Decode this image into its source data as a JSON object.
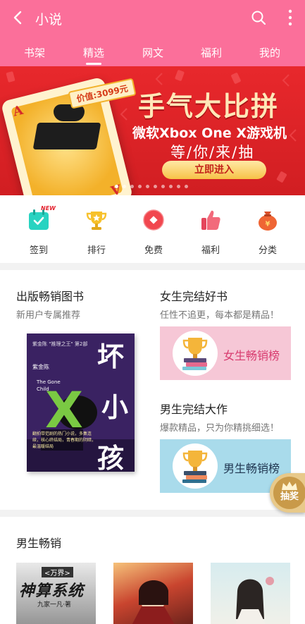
{
  "header": {
    "title": "小说",
    "tabs": [
      {
        "label": "书架"
      },
      {
        "label": "精选"
      },
      {
        "label": "网文"
      },
      {
        "label": "福利"
      },
      {
        "label": "我的"
      }
    ],
    "active_tab": "精选"
  },
  "banner": {
    "price": "价值:3099元",
    "headline": "手气大比拼",
    "subline": "微软Xbox One X游戏机",
    "tagline": "等/你/来/抽",
    "button": "立即进入",
    "card_letter": "A",
    "dot_count": 10,
    "active_dot": 0
  },
  "quick_nav": [
    {
      "label": "签到",
      "icon": "calendar-check-icon",
      "badge": "NEW"
    },
    {
      "label": "排行",
      "icon": "trophy-icon"
    },
    {
      "label": "免费",
      "icon": "diamond-coin-icon"
    },
    {
      "label": "福利",
      "icon": "thumbs-up-icon"
    },
    {
      "label": "分类",
      "icon": "money-bag-icon"
    }
  ],
  "section_featured": {
    "left": {
      "title": "出版畅销图书",
      "subtitle": "新用户专属推荐",
      "book": {
        "title_chars": [
          "坏",
          "小",
          "孩"
        ],
        "series": "紫金陈 \"推理之王\" 第2部",
        "author": "紫金陈",
        "en_title": "The Gone Child",
        "blurb": "翻拍带范剧的热门小说，多集连续，核心终结局，青春期的阴暗，最温暖结局"
      }
    },
    "right_top": {
      "title": "女生完结好书",
      "subtitle": "任性不追更，每本都是精品！",
      "card_label": "女生畅销榜"
    },
    "right_bottom": {
      "title": "男生完结大作",
      "subtitle": "爆款精品，只为你精挑细选！",
      "card_label": "男生畅销榜"
    }
  },
  "lottery": {
    "label": "抽奖"
  },
  "section_male": {
    "title": "男生畅销",
    "books": [
      {
        "cover_text": "神算系统",
        "cover_sub": "<万界>",
        "author_text": "九家一凡·著"
      },
      {
        "cover_text": ""
      },
      {
        "cover_text": ""
      }
    ]
  },
  "colors": {
    "header_pink": "#fb6f9a",
    "banner_red": "#e8282c",
    "girl_card": "#f6c7d6",
    "boy_card": "#a9dbeb",
    "girl_label": "#d83b6f",
    "boy_label": "#1f3550"
  }
}
